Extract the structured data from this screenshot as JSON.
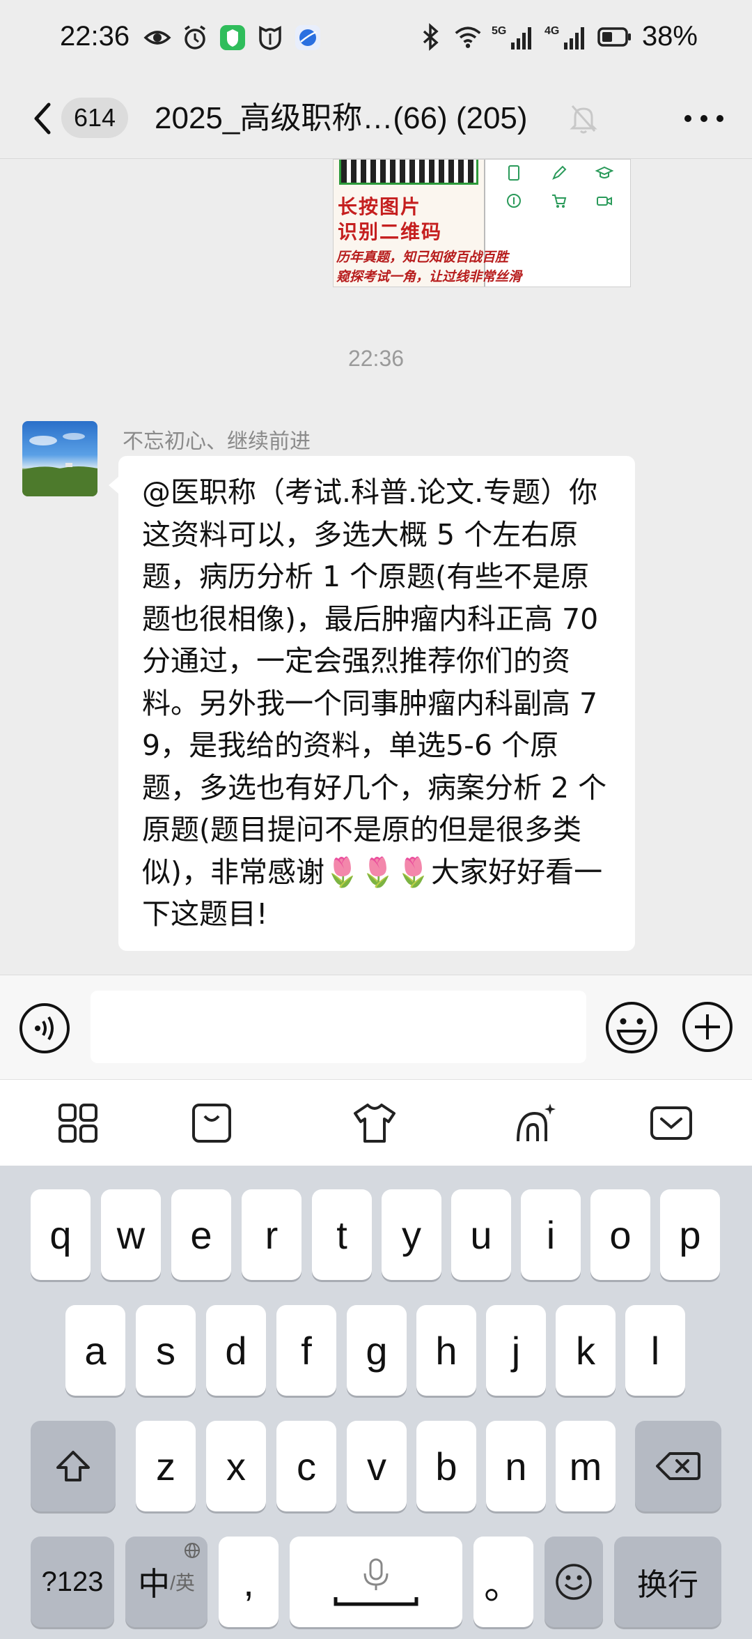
{
  "status_bar": {
    "time": "22:36",
    "network_5g": "5G",
    "network_4g": "4G",
    "battery": "38%"
  },
  "header": {
    "unread_count": "614",
    "title": "2025_高级职称…(66) (205)"
  },
  "shared_image": {
    "line1": "长按图片",
    "line2": "识别二维码",
    "caption1": "历年真题，知己知彼百战百胜",
    "caption2": "窥探考试一角，让过线非常丝滑"
  },
  "chat": {
    "timestamp": "22:36",
    "sender": "不忘初心、继续前进",
    "message": "@医职称（考试.科普.论文.专题）你这资料可以，多选大概 5 个左右原题，病历分析 1 个原题(有些不是原题也很相像)，最后肿瘤内科正高 70 分通过，一定会强烈推荐你们的资料。另外我一个同事肿瘤内科副高 79，是我给的资料，单选5-6 个原题，多选也有好几个，病案分析 2 个原题(题目提问不是原的但是很多类似)，非常感谢🌷🌷🌷大家好好看一下这题目!"
  },
  "input": {
    "value": ""
  },
  "keyboard": {
    "row1": [
      "q",
      "w",
      "e",
      "r",
      "t",
      "y",
      "u",
      "i",
      "o",
      "p"
    ],
    "row2": [
      "a",
      "s",
      "d",
      "f",
      "g",
      "h",
      "j",
      "k",
      "l"
    ],
    "row3": [
      "z",
      "x",
      "c",
      "v",
      "b",
      "n",
      "m"
    ],
    "numbers_key": "?123",
    "lang_key_main": "中",
    "lang_key_sub": "/英",
    "comma_key": ",",
    "period_key": "。",
    "enter_key": "换行"
  },
  "colors": {
    "background": "#ededed",
    "bubble": "#ffffff",
    "keyboard_bg": "#d5d9df",
    "qr_green": "#2c9a3a",
    "qr_red": "#c51f1f"
  },
  "icons": {
    "status": [
      "eye-icon",
      "alarm-icon",
      "app-badge-icon",
      "shield-icon",
      "browser-icon",
      "bluetooth-icon",
      "wifi-icon",
      "signal-icon",
      "battery-icon"
    ],
    "header": [
      "back-chevron-icon",
      "mute-bell-icon",
      "more-icon"
    ],
    "input": [
      "voice-icon",
      "emoji-icon",
      "plus-icon"
    ],
    "toolbar": [
      "apps-grid-icon",
      "bag-icon",
      "tshirt-icon",
      "ai-sparkle-icon",
      "collapse-keyboard-icon"
    ]
  }
}
